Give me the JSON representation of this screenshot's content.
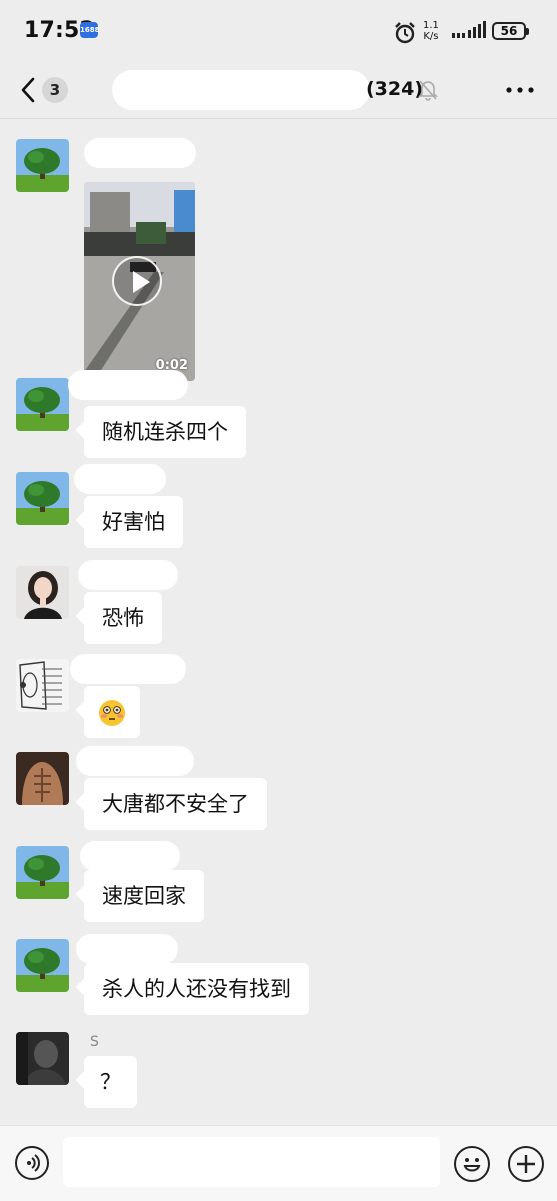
{
  "status_bar": {
    "time": "17:52",
    "app_badge": "1688",
    "net_speed_value": "1.1",
    "net_speed_unit": "K/s",
    "battery": "56"
  },
  "header": {
    "unread_count": "3",
    "title_suffix": "(324)",
    "icons": [
      "back-icon",
      "bell-mute-icon",
      "more-icon"
    ]
  },
  "messages": [
    {
      "sender": "",
      "type": "video",
      "duration": "0:02",
      "avatar": "tree"
    },
    {
      "sender": "",
      "type": "text",
      "text": "随机连杀四个",
      "avatar": "tree"
    },
    {
      "sender": "",
      "type": "text",
      "text": "好害怕",
      "avatar": "tree"
    },
    {
      "sender": "",
      "type": "text",
      "text": "恐怖",
      "avatar": "girl"
    },
    {
      "sender": "",
      "type": "emoji",
      "text": "😳",
      "avatar": "diagram"
    },
    {
      "sender": "",
      "type": "text",
      "text": "大唐都不安全了",
      "avatar": "torso"
    },
    {
      "sender": "",
      "type": "text",
      "text": "速度回家",
      "avatar": "tree"
    },
    {
      "sender": "",
      "type": "text",
      "text": "杀人的人还没有找到",
      "avatar": "tree"
    },
    {
      "sender": "S",
      "type": "text",
      "text": "？",
      "avatar": "dark"
    }
  ],
  "input_bar": {
    "value": "",
    "icons": [
      "voice-icon",
      "emoji-icon",
      "plus-icon"
    ]
  },
  "colors": {
    "background": "#ededed",
    "bubble": "#ffffff",
    "text": "#111111",
    "sender": "#888888"
  }
}
